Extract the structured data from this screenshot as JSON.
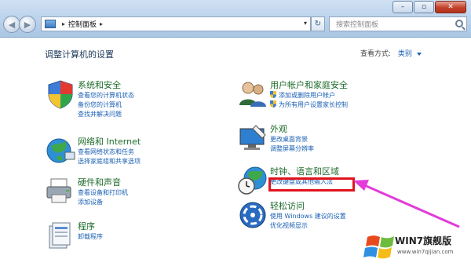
{
  "window": {
    "minimize_glyph": "–",
    "maximize_glyph": "▫",
    "close_glyph": "✕"
  },
  "address_bar": {
    "crumb": "控制面板",
    "separator": "▸",
    "dropdown_glyph": "▾",
    "refresh_glyph": "↻"
  },
  "search": {
    "placeholder": "搜索控制面板"
  },
  "page": {
    "title": "调整计算机的设置",
    "view_by_label": "查看方式:",
    "view_by_value": "类别"
  },
  "categories": {
    "system": {
      "title": "系统和安全",
      "links": [
        "查看您的计算机状态",
        "备份您的计算机",
        "查找并解决问题"
      ]
    },
    "network": {
      "title": "网络和 Internet",
      "links": [
        "查看网络状态和任务",
        "选择家庭组和共享选项"
      ]
    },
    "hardware": {
      "title": "硬件和声音",
      "links": [
        "查看设备和打印机",
        "添加设备"
      ]
    },
    "programs": {
      "title": "程序",
      "links": [
        "卸载程序"
      ]
    },
    "user": {
      "title": "用户帐户和家庭安全",
      "links": [
        "添加或删除用户帐户",
        "为所有用户设置家长控制"
      ]
    },
    "appearance": {
      "title": "外观",
      "links": [
        "更改桌面背景",
        "调整屏幕分辨率"
      ]
    },
    "clock": {
      "title": "时钟、语言和区域",
      "links": [
        "更改键盘或其他输入法"
      ]
    },
    "ease": {
      "title": "轻松访问",
      "links": [
        "使用 Windows 建议的设置",
        "优化视频显示"
      ]
    }
  },
  "watermark": {
    "text": "WIN7旗舰版",
    "url": "www.win7qijian.com"
  },
  "colors": {
    "link": "#1a5fb4",
    "category_title": "#1e6b2b",
    "highlight": "#e0141e",
    "arrow": "#e33bd9"
  }
}
